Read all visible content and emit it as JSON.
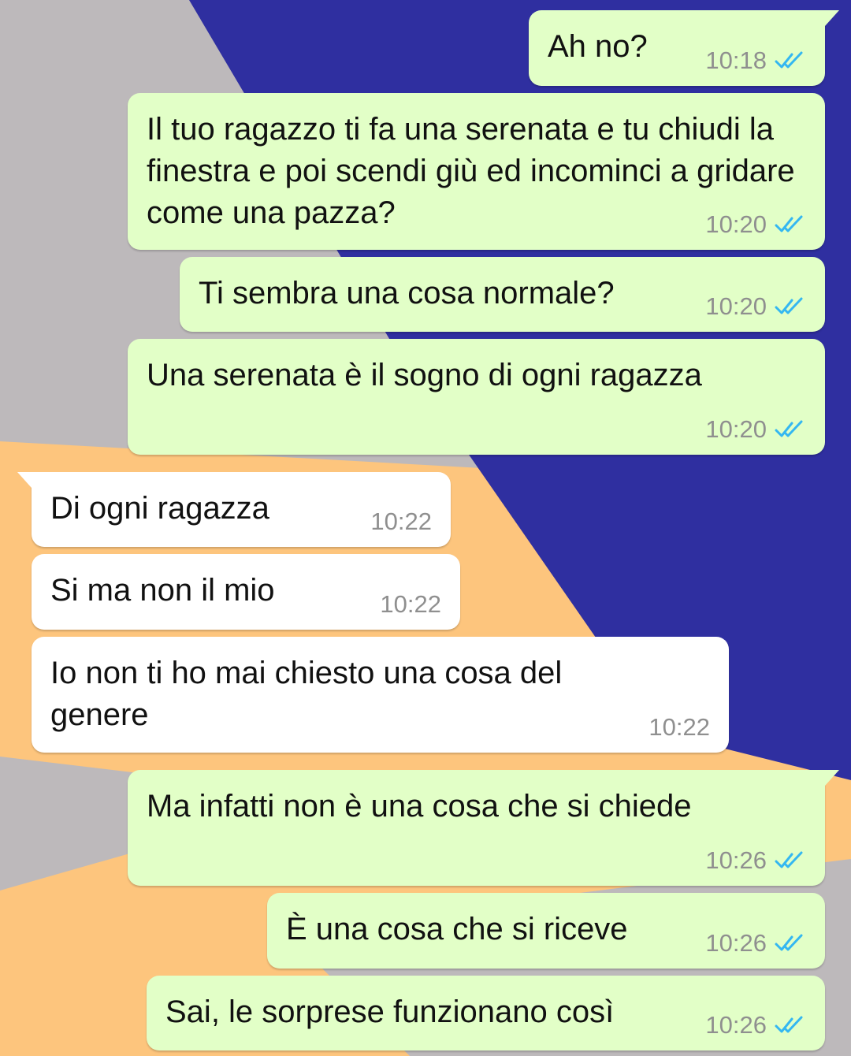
{
  "colors": {
    "outgoing_bubble": "#e2ffc7",
    "incoming_bubble": "#ffffff",
    "read_ticks": "#34b7f1",
    "time_text": "#8f8f8f",
    "wallpaper_blue": "#2f2fa0",
    "wallpaper_orange": "#fdc57d",
    "wallpaper_grey": "#bdb9bb"
  },
  "messages": [
    {
      "id": "m1",
      "direction": "outgoing",
      "text": "Ah no?",
      "time": "10:18",
      "status": "read-ticks-icon"
    },
    {
      "id": "m2",
      "direction": "outgoing",
      "text": "Il tuo ragazzo ti fa una serenata e tu chiudi la finestra e poi scendi giù ed incominci a gridare come una pazza?",
      "time": "10:20",
      "status": "read-ticks-icon"
    },
    {
      "id": "m3",
      "direction": "outgoing",
      "text": "Ti sembra una cosa normale?",
      "time": "10:20",
      "status": "read-ticks-icon"
    },
    {
      "id": "m4",
      "direction": "outgoing",
      "text": "Una serenata è il sogno di ogni ragazza",
      "time": "10:20",
      "status": "read-ticks-icon"
    },
    {
      "id": "m5",
      "direction": "incoming",
      "text": "Di ogni ragazza",
      "time": "10:22"
    },
    {
      "id": "m6",
      "direction": "incoming",
      "text": "Si ma non il mio",
      "time": "10:22"
    },
    {
      "id": "m7",
      "direction": "incoming",
      "text": "Io non ti ho mai chiesto una cosa del genere",
      "time": "10:22"
    },
    {
      "id": "m8",
      "direction": "outgoing",
      "text": "Ma infatti non è una cosa che si chiede",
      "time": "10:26",
      "status": "read-ticks-icon"
    },
    {
      "id": "m9",
      "direction": "outgoing",
      "text": "È una cosa che si riceve",
      "time": "10:26",
      "status": "read-ticks-icon"
    },
    {
      "id": "m10",
      "direction": "outgoing",
      "text": "Sai, le sorprese funzionano così",
      "time": "10:26",
      "status": "read-ticks-icon"
    }
  ]
}
